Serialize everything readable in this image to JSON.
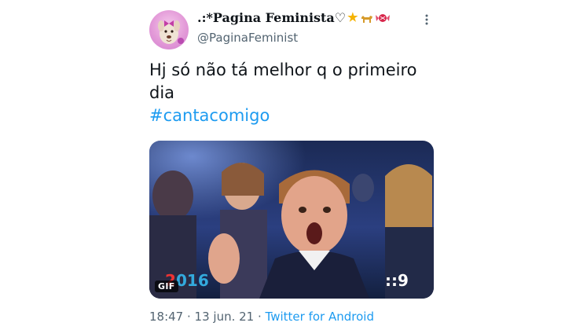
{
  "author": {
    "display_name": ".:*Pagina Feminista♡",
    "emoji": [
      "star",
      "dog",
      "candy"
    ],
    "handle": "@PaginaFeminist"
  },
  "tweet": {
    "text_line1": "Hj só não tá melhor q o primeiro",
    "text_line2": "dia",
    "hashtag": "#cantacomigo"
  },
  "media": {
    "badge": "GIF",
    "watermark_left": "2016",
    "watermark_right": "9"
  },
  "footer": {
    "time": "18:47",
    "separator": " · ",
    "date": "13 jun. 21",
    "source": "Twitter for Android"
  },
  "colors": {
    "link": "#1d9bf0",
    "secondary": "#536471"
  }
}
